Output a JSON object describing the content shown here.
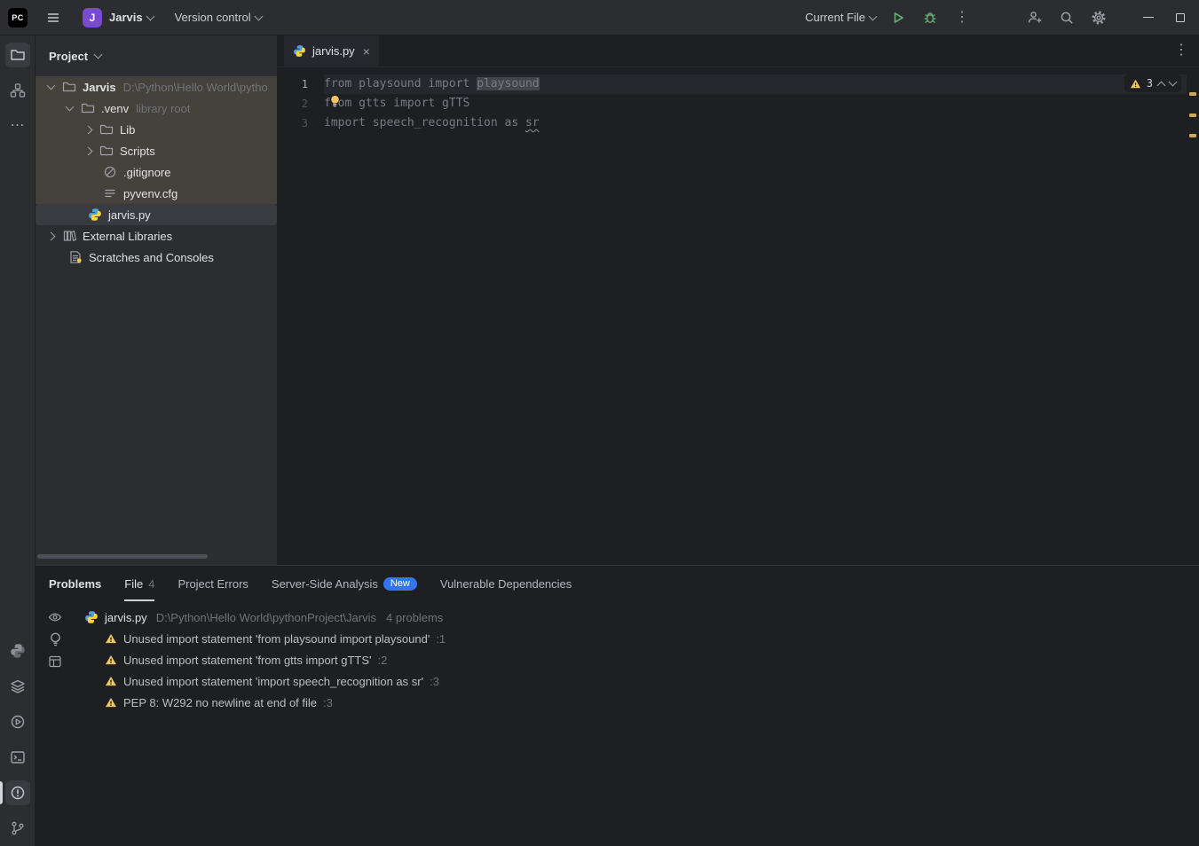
{
  "titlebar": {
    "logo_text": "PC",
    "project": {
      "avatar": "J",
      "name": "Jarvis"
    },
    "vcs_label": "Version control",
    "run_config_label": "Current File"
  },
  "icons": {
    "close": "×",
    "kebab": "⋮",
    "ellipsis": "⋯"
  },
  "project_panel": {
    "title": "Project",
    "tree": [
      {
        "label": "Jarvis",
        "hint": "D:\\Python\\Hello World\\pytho"
      },
      {
        "label": ".venv",
        "hint": "library root"
      },
      {
        "label": "Lib"
      },
      {
        "label": "Scripts"
      },
      {
        "label": ".gitignore"
      },
      {
        "label": "pyvenv.cfg"
      },
      {
        "label": "jarvis.py"
      },
      {
        "label": "External Libraries"
      },
      {
        "label": "Scratches and Consoles"
      }
    ]
  },
  "editor": {
    "tab_title": "jarvis.py",
    "lines": [
      {
        "no": "1",
        "pre": "from playsound import ",
        "highlight": "playsound"
      },
      {
        "no": "2",
        "text": "from gtts import gTTS"
      },
      {
        "no": "3",
        "pre": "import speech_recognition as ",
        "underline": "sr"
      }
    ],
    "inspection_warnings": "3"
  },
  "problems_panel": {
    "title": "Problems",
    "tabs": [
      {
        "label": "File",
        "count": "4"
      },
      {
        "label": "Project Errors"
      },
      {
        "label": "Server-Side Analysis",
        "badge": "New"
      },
      {
        "label": "Vulnerable Dependencies"
      }
    ],
    "file_row": {
      "name": "jarvis.py",
      "path": "D:\\Python\\Hello World\\pythonProject\\Jarvis",
      "summary": "4 problems"
    },
    "items": [
      {
        "text": "Unused import statement 'from playsound import playsound'",
        "loc": ":1"
      },
      {
        "text": "Unused import statement 'from gtts import gTTS'",
        "loc": ":2"
      },
      {
        "text": "Unused import statement 'import speech_recognition as sr'",
        "loc": ":3"
      },
      {
        "text": "PEP 8: W292 no newline at end of file",
        "loc": ":3"
      }
    ]
  },
  "colors": {
    "accent_blue": "#3574f0",
    "warning_yellow": "#f2c55c",
    "run_green": "#6aab73",
    "excluded_row_bg": "#45423b",
    "selection_bg": "#393b40"
  }
}
